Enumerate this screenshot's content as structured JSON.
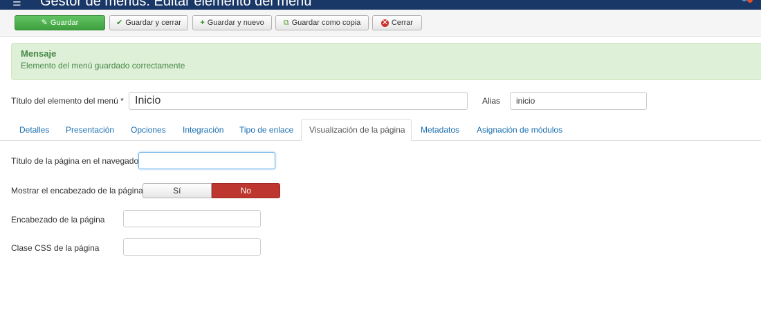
{
  "header": {
    "title": "Gestor de menús: Editar elemento del menú"
  },
  "toolbar": {
    "save_label": "Guardar",
    "save_close_label": "Guardar y cerrar",
    "save_new_label": "Guardar y nuevo",
    "save_copy_label": "Guardar como copia",
    "close_label": "Cerrar"
  },
  "message": {
    "heading": "Mensaje",
    "text": "Elemento del menú guardado correctamente"
  },
  "form": {
    "title_label": "Título del elemento del menú *",
    "title_value": "Inicio",
    "alias_label": "Alias",
    "alias_value": "inicio"
  },
  "tabs": [
    {
      "label": "Detalles"
    },
    {
      "label": "Presentación"
    },
    {
      "label": "Opciones"
    },
    {
      "label": "Integración"
    },
    {
      "label": "Tipo de enlace"
    },
    {
      "label": "Visualización de la página"
    },
    {
      "label": "Metadatos"
    },
    {
      "label": "Asignación de módulos"
    }
  ],
  "active_tab": "Visualización de la página",
  "fields": {
    "browser_title_label": "Título de la página en el navegador",
    "browser_title_value": "",
    "show_heading_label": "Mostrar el encabezado de la página",
    "show_heading_yes": "Sí",
    "show_heading_no": "No",
    "show_heading_selected": "No",
    "page_heading_label": "Encabezado de la página",
    "page_heading_value": "",
    "css_class_label": "Clase CSS de la página",
    "css_class_value": ""
  },
  "colors": {
    "header_bg": "#1a3867",
    "save_green": "#51a351",
    "alert_bg": "#dff0d8",
    "alert_text": "#468847",
    "toggle_no": "#bd362f",
    "tab_link": "#1a6eb0"
  }
}
